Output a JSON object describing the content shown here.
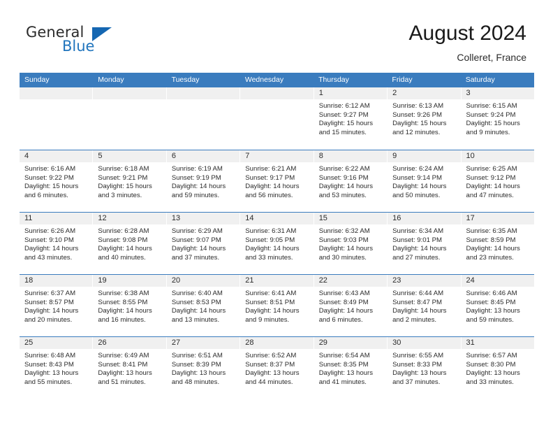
{
  "brand": {
    "name_top": "General",
    "name_bottom": "Blue",
    "triangle_color": "#1567b2",
    "blue_color": "#2175bd"
  },
  "header": {
    "title": "August 2024",
    "subtitle": "Colleret, France"
  },
  "theme": {
    "header_blue": "#3a7cbe",
    "daynum_band": "#f0f0f0",
    "text": "#2b2b2b"
  },
  "weekdays": [
    "Sunday",
    "Monday",
    "Tuesday",
    "Wednesday",
    "Thursday",
    "Friday",
    "Saturday"
  ],
  "weeks": [
    [
      {
        "day": "",
        "lines": []
      },
      {
        "day": "",
        "lines": []
      },
      {
        "day": "",
        "lines": []
      },
      {
        "day": "",
        "lines": []
      },
      {
        "day": "1",
        "lines": [
          "Sunrise: 6:12 AM",
          "Sunset: 9:27 PM",
          "Daylight: 15 hours",
          "and 15 minutes."
        ]
      },
      {
        "day": "2",
        "lines": [
          "Sunrise: 6:13 AM",
          "Sunset: 9:26 PM",
          "Daylight: 15 hours",
          "and 12 minutes."
        ]
      },
      {
        "day": "3",
        "lines": [
          "Sunrise: 6:15 AM",
          "Sunset: 9:24 PM",
          "Daylight: 15 hours",
          "and 9 minutes."
        ]
      }
    ],
    [
      {
        "day": "4",
        "lines": [
          "Sunrise: 6:16 AM",
          "Sunset: 9:22 PM",
          "Daylight: 15 hours",
          "and 6 minutes."
        ]
      },
      {
        "day": "5",
        "lines": [
          "Sunrise: 6:18 AM",
          "Sunset: 9:21 PM",
          "Daylight: 15 hours",
          "and 3 minutes."
        ]
      },
      {
        "day": "6",
        "lines": [
          "Sunrise: 6:19 AM",
          "Sunset: 9:19 PM",
          "Daylight: 14 hours",
          "and 59 minutes."
        ]
      },
      {
        "day": "7",
        "lines": [
          "Sunrise: 6:21 AM",
          "Sunset: 9:17 PM",
          "Daylight: 14 hours",
          "and 56 minutes."
        ]
      },
      {
        "day": "8",
        "lines": [
          "Sunrise: 6:22 AM",
          "Sunset: 9:16 PM",
          "Daylight: 14 hours",
          "and 53 minutes."
        ]
      },
      {
        "day": "9",
        "lines": [
          "Sunrise: 6:24 AM",
          "Sunset: 9:14 PM",
          "Daylight: 14 hours",
          "and 50 minutes."
        ]
      },
      {
        "day": "10",
        "lines": [
          "Sunrise: 6:25 AM",
          "Sunset: 9:12 PM",
          "Daylight: 14 hours",
          "and 47 minutes."
        ]
      }
    ],
    [
      {
        "day": "11",
        "lines": [
          "Sunrise: 6:26 AM",
          "Sunset: 9:10 PM",
          "Daylight: 14 hours",
          "and 43 minutes."
        ]
      },
      {
        "day": "12",
        "lines": [
          "Sunrise: 6:28 AM",
          "Sunset: 9:08 PM",
          "Daylight: 14 hours",
          "and 40 minutes."
        ]
      },
      {
        "day": "13",
        "lines": [
          "Sunrise: 6:29 AM",
          "Sunset: 9:07 PM",
          "Daylight: 14 hours",
          "and 37 minutes."
        ]
      },
      {
        "day": "14",
        "lines": [
          "Sunrise: 6:31 AM",
          "Sunset: 9:05 PM",
          "Daylight: 14 hours",
          "and 33 minutes."
        ]
      },
      {
        "day": "15",
        "lines": [
          "Sunrise: 6:32 AM",
          "Sunset: 9:03 PM",
          "Daylight: 14 hours",
          "and 30 minutes."
        ]
      },
      {
        "day": "16",
        "lines": [
          "Sunrise: 6:34 AM",
          "Sunset: 9:01 PM",
          "Daylight: 14 hours",
          "and 27 minutes."
        ]
      },
      {
        "day": "17",
        "lines": [
          "Sunrise: 6:35 AM",
          "Sunset: 8:59 PM",
          "Daylight: 14 hours",
          "and 23 minutes."
        ]
      }
    ],
    [
      {
        "day": "18",
        "lines": [
          "Sunrise: 6:37 AM",
          "Sunset: 8:57 PM",
          "Daylight: 14 hours",
          "and 20 minutes."
        ]
      },
      {
        "day": "19",
        "lines": [
          "Sunrise: 6:38 AM",
          "Sunset: 8:55 PM",
          "Daylight: 14 hours",
          "and 16 minutes."
        ]
      },
      {
        "day": "20",
        "lines": [
          "Sunrise: 6:40 AM",
          "Sunset: 8:53 PM",
          "Daylight: 14 hours",
          "and 13 minutes."
        ]
      },
      {
        "day": "21",
        "lines": [
          "Sunrise: 6:41 AM",
          "Sunset: 8:51 PM",
          "Daylight: 14 hours",
          "and 9 minutes."
        ]
      },
      {
        "day": "22",
        "lines": [
          "Sunrise: 6:43 AM",
          "Sunset: 8:49 PM",
          "Daylight: 14 hours",
          "and 6 minutes."
        ]
      },
      {
        "day": "23",
        "lines": [
          "Sunrise: 6:44 AM",
          "Sunset: 8:47 PM",
          "Daylight: 14 hours",
          "and 2 minutes."
        ]
      },
      {
        "day": "24",
        "lines": [
          "Sunrise: 6:46 AM",
          "Sunset: 8:45 PM",
          "Daylight: 13 hours",
          "and 59 minutes."
        ]
      }
    ],
    [
      {
        "day": "25",
        "lines": [
          "Sunrise: 6:48 AM",
          "Sunset: 8:43 PM",
          "Daylight: 13 hours",
          "and 55 minutes."
        ]
      },
      {
        "day": "26",
        "lines": [
          "Sunrise: 6:49 AM",
          "Sunset: 8:41 PM",
          "Daylight: 13 hours",
          "and 51 minutes."
        ]
      },
      {
        "day": "27",
        "lines": [
          "Sunrise: 6:51 AM",
          "Sunset: 8:39 PM",
          "Daylight: 13 hours",
          "and 48 minutes."
        ]
      },
      {
        "day": "28",
        "lines": [
          "Sunrise: 6:52 AM",
          "Sunset: 8:37 PM",
          "Daylight: 13 hours",
          "and 44 minutes."
        ]
      },
      {
        "day": "29",
        "lines": [
          "Sunrise: 6:54 AM",
          "Sunset: 8:35 PM",
          "Daylight: 13 hours",
          "and 41 minutes."
        ]
      },
      {
        "day": "30",
        "lines": [
          "Sunrise: 6:55 AM",
          "Sunset: 8:33 PM",
          "Daylight: 13 hours",
          "and 37 minutes."
        ]
      },
      {
        "day": "31",
        "lines": [
          "Sunrise: 6:57 AM",
          "Sunset: 8:30 PM",
          "Daylight: 13 hours",
          "and 33 minutes."
        ]
      }
    ]
  ]
}
